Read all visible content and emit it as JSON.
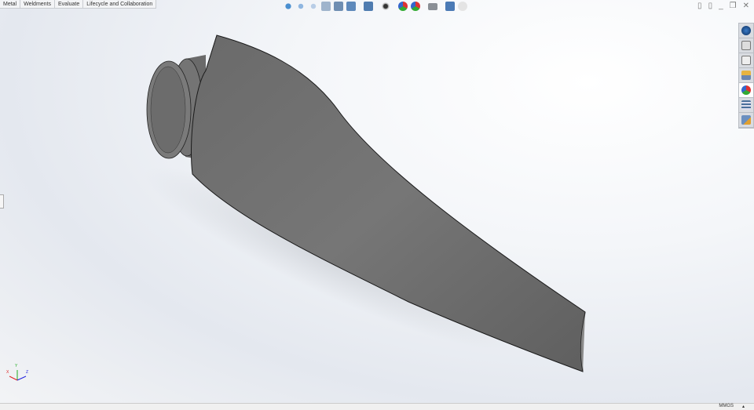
{
  "tabs": [
    "Metal",
    "Weldments",
    "Evaluate",
    "Lifecycle and Collaboration"
  ],
  "heads_up_toolbar": [
    "zoom-to-fit-icon",
    "zoom-to-area-icon",
    "previous-view-icon",
    "section-view-icon",
    "dynamic-annotation-icon",
    "view-orientation-icon",
    "display-style-icon",
    "hide-show-items-icon",
    "edit-appearance-icon",
    "apply-scene-icon",
    "view-settings-icon",
    "evaluate-icon",
    "realview-icon"
  ],
  "window_controls": [
    "tile-left-icon",
    "tile-right-icon",
    "minimize-icon",
    "restore-icon",
    "close-icon"
  ],
  "task_pane": [
    "solidworks-resources-icon",
    "design-library-icon",
    "file-explorer-icon",
    "view-palette-icon",
    "appearances-icon",
    "custom-properties-icon",
    "forum-icon"
  ],
  "triad": {
    "x": "X",
    "y": "Y",
    "z": "Z"
  },
  "status_bar": {
    "units": "MMGS",
    "arrow": "▴"
  },
  "colors": {
    "part": "#6e6e6e",
    "accent": "#1f5fa8"
  }
}
